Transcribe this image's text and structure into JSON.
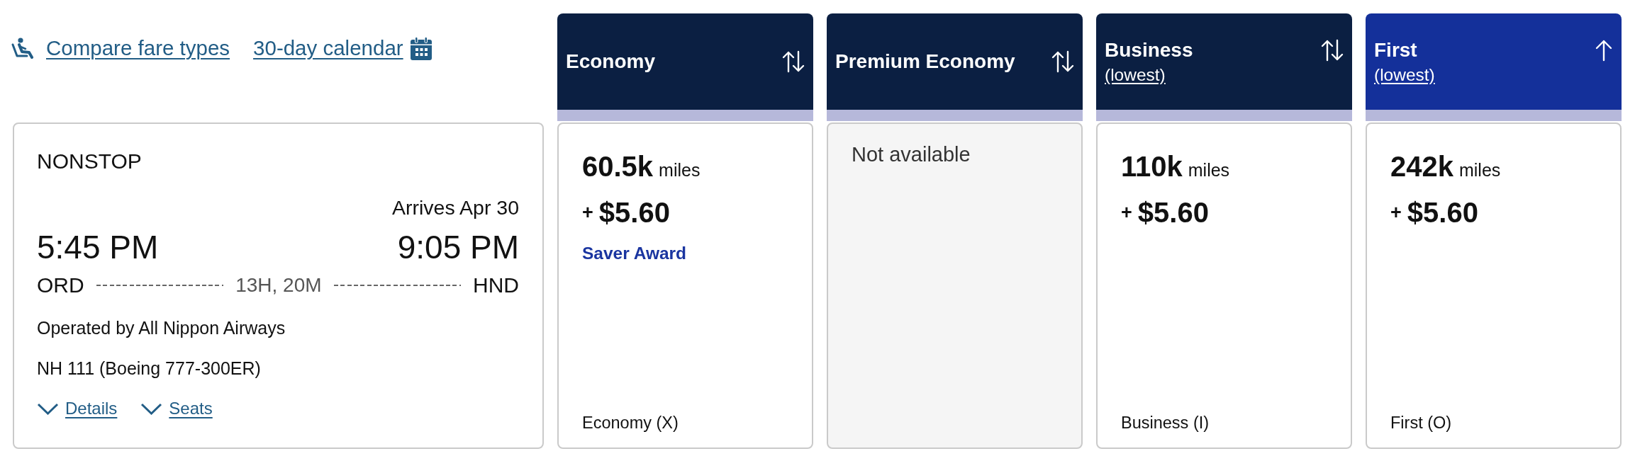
{
  "compare_link": {
    "label": "Compare fare types"
  },
  "calendar_link": {
    "label": "30-day calendar"
  },
  "flight": {
    "stops": "NONSTOP",
    "arrival_note": "Arrives Apr 30",
    "depart_time": "5:45 PM",
    "arrive_time": "9:05 PM",
    "origin": "ORD",
    "destination": "HND",
    "duration": "13H, 20M",
    "operator": "Operated by All Nippon Airways",
    "flight_number": "NH 111 (Boeing 777-300ER)",
    "toggles": [
      {
        "label": "Details",
        "expanded": false
      },
      {
        "label": "Seats",
        "expanded": false
      }
    ]
  },
  "fare_columns": [
    {
      "title": "Economy",
      "selected": false,
      "kind": "fare",
      "miles": "60.5k",
      "miles_unit": "miles",
      "plus": "+",
      "taxes": "$5.60",
      "award": "Saver Award",
      "cabin": "Economy (X)"
    },
    {
      "title": "Premium Economy",
      "selected": false,
      "kind": "unavailable",
      "message": "Not available"
    },
    {
      "title": "Business",
      "subtitle": "(lowest)",
      "selected": false,
      "kind": "fare",
      "miles": "110k",
      "miles_unit": "miles",
      "plus": "+",
      "taxes": "$5.60",
      "cabin": "Business (I)"
    },
    {
      "title": "First",
      "subtitle": "(lowest)",
      "selected": true,
      "kind": "fare",
      "miles": "242k",
      "miles_unit": "miles",
      "plus": "+",
      "taxes": "$5.60",
      "cabin": "First (O)"
    }
  ]
}
